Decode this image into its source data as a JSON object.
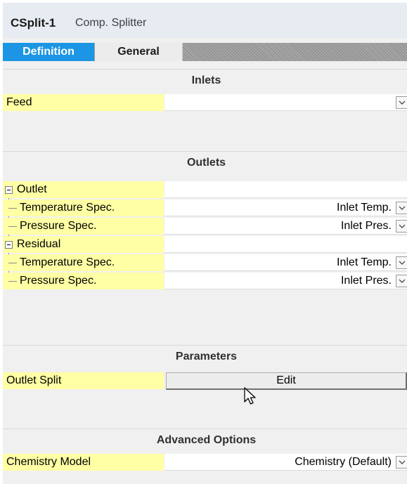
{
  "header": {
    "title": "CSplit-1",
    "subtitle": "Comp. Splitter"
  },
  "tabs": [
    {
      "label": "Definition",
      "active": true
    },
    {
      "label": "General",
      "active": false
    }
  ],
  "sections": {
    "inlets": {
      "title": "Inlets",
      "feed_label": "Feed",
      "feed_value": ""
    },
    "outlets": {
      "title": "Outlets",
      "outlet_label": "Outlet",
      "outlet_temp_label": "Temperature Spec.",
      "outlet_temp_value": "Inlet Temp.",
      "outlet_pres_label": "Pressure Spec.",
      "outlet_pres_value": "Inlet Pres.",
      "residual_label": "Residual",
      "residual_temp_label": "Temperature Spec.",
      "residual_temp_value": "Inlet Temp.",
      "residual_pres_label": "Pressure Spec.",
      "residual_pres_value": "Inlet Pres."
    },
    "parameters": {
      "title": "Parameters",
      "outlet_split_label": "Outlet Split",
      "edit_label": "Edit"
    },
    "advanced": {
      "title": "Advanced Options",
      "chemistry_label": "Chemistry Model",
      "chemistry_value": "Chemistry (Default)"
    }
  },
  "icons": {
    "dropdown": "chevron-down-icon",
    "tree_toggle": "minus-box-icon",
    "cursor": "mouse-pointer-icon"
  },
  "colors": {
    "tab_active": "#1c96e4",
    "label_bg": "#ffffa5",
    "header_bg": "#e7ebf2"
  }
}
